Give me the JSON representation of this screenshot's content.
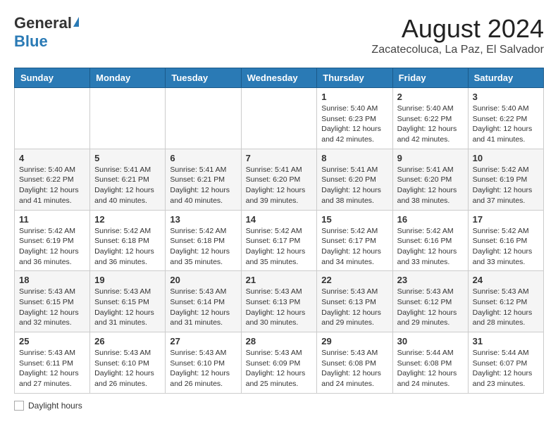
{
  "header": {
    "logo_general": "General",
    "logo_blue": "Blue",
    "month_title": "August 2024",
    "location": "Zacatecoluca, La Paz, El Salvador"
  },
  "days_of_week": [
    "Sunday",
    "Monday",
    "Tuesday",
    "Wednesday",
    "Thursday",
    "Friday",
    "Saturday"
  ],
  "weeks": [
    [
      {
        "day": "",
        "info": ""
      },
      {
        "day": "",
        "info": ""
      },
      {
        "day": "",
        "info": ""
      },
      {
        "day": "",
        "info": ""
      },
      {
        "day": "1",
        "info": "Sunrise: 5:40 AM\nSunset: 6:23 PM\nDaylight: 12 hours\nand 42 minutes."
      },
      {
        "day": "2",
        "info": "Sunrise: 5:40 AM\nSunset: 6:22 PM\nDaylight: 12 hours\nand 42 minutes."
      },
      {
        "day": "3",
        "info": "Sunrise: 5:40 AM\nSunset: 6:22 PM\nDaylight: 12 hours\nand 41 minutes."
      }
    ],
    [
      {
        "day": "4",
        "info": "Sunrise: 5:40 AM\nSunset: 6:22 PM\nDaylight: 12 hours\nand 41 minutes."
      },
      {
        "day": "5",
        "info": "Sunrise: 5:41 AM\nSunset: 6:21 PM\nDaylight: 12 hours\nand 40 minutes."
      },
      {
        "day": "6",
        "info": "Sunrise: 5:41 AM\nSunset: 6:21 PM\nDaylight: 12 hours\nand 40 minutes."
      },
      {
        "day": "7",
        "info": "Sunrise: 5:41 AM\nSunset: 6:20 PM\nDaylight: 12 hours\nand 39 minutes."
      },
      {
        "day": "8",
        "info": "Sunrise: 5:41 AM\nSunset: 6:20 PM\nDaylight: 12 hours\nand 38 minutes."
      },
      {
        "day": "9",
        "info": "Sunrise: 5:41 AM\nSunset: 6:20 PM\nDaylight: 12 hours\nand 38 minutes."
      },
      {
        "day": "10",
        "info": "Sunrise: 5:42 AM\nSunset: 6:19 PM\nDaylight: 12 hours\nand 37 minutes."
      }
    ],
    [
      {
        "day": "11",
        "info": "Sunrise: 5:42 AM\nSunset: 6:19 PM\nDaylight: 12 hours\nand 36 minutes."
      },
      {
        "day": "12",
        "info": "Sunrise: 5:42 AM\nSunset: 6:18 PM\nDaylight: 12 hours\nand 36 minutes."
      },
      {
        "day": "13",
        "info": "Sunrise: 5:42 AM\nSunset: 6:18 PM\nDaylight: 12 hours\nand 35 minutes."
      },
      {
        "day": "14",
        "info": "Sunrise: 5:42 AM\nSunset: 6:17 PM\nDaylight: 12 hours\nand 35 minutes."
      },
      {
        "day": "15",
        "info": "Sunrise: 5:42 AM\nSunset: 6:17 PM\nDaylight: 12 hours\nand 34 minutes."
      },
      {
        "day": "16",
        "info": "Sunrise: 5:42 AM\nSunset: 6:16 PM\nDaylight: 12 hours\nand 33 minutes."
      },
      {
        "day": "17",
        "info": "Sunrise: 5:42 AM\nSunset: 6:16 PM\nDaylight: 12 hours\nand 33 minutes."
      }
    ],
    [
      {
        "day": "18",
        "info": "Sunrise: 5:43 AM\nSunset: 6:15 PM\nDaylight: 12 hours\nand 32 minutes."
      },
      {
        "day": "19",
        "info": "Sunrise: 5:43 AM\nSunset: 6:15 PM\nDaylight: 12 hours\nand 31 minutes."
      },
      {
        "day": "20",
        "info": "Sunrise: 5:43 AM\nSunset: 6:14 PM\nDaylight: 12 hours\nand 31 minutes."
      },
      {
        "day": "21",
        "info": "Sunrise: 5:43 AM\nSunset: 6:13 PM\nDaylight: 12 hours\nand 30 minutes."
      },
      {
        "day": "22",
        "info": "Sunrise: 5:43 AM\nSunset: 6:13 PM\nDaylight: 12 hours\nand 29 minutes."
      },
      {
        "day": "23",
        "info": "Sunrise: 5:43 AM\nSunset: 6:12 PM\nDaylight: 12 hours\nand 29 minutes."
      },
      {
        "day": "24",
        "info": "Sunrise: 5:43 AM\nSunset: 6:12 PM\nDaylight: 12 hours\nand 28 minutes."
      }
    ],
    [
      {
        "day": "25",
        "info": "Sunrise: 5:43 AM\nSunset: 6:11 PM\nDaylight: 12 hours\nand 27 minutes."
      },
      {
        "day": "26",
        "info": "Sunrise: 5:43 AM\nSunset: 6:10 PM\nDaylight: 12 hours\nand 26 minutes."
      },
      {
        "day": "27",
        "info": "Sunrise: 5:43 AM\nSunset: 6:10 PM\nDaylight: 12 hours\nand 26 minutes."
      },
      {
        "day": "28",
        "info": "Sunrise: 5:43 AM\nSunset: 6:09 PM\nDaylight: 12 hours\nand 25 minutes."
      },
      {
        "day": "29",
        "info": "Sunrise: 5:43 AM\nSunset: 6:08 PM\nDaylight: 12 hours\nand 24 minutes."
      },
      {
        "day": "30",
        "info": "Sunrise: 5:44 AM\nSunset: 6:08 PM\nDaylight: 12 hours\nand 24 minutes."
      },
      {
        "day": "31",
        "info": "Sunrise: 5:44 AM\nSunset: 6:07 PM\nDaylight: 12 hours\nand 23 minutes."
      }
    ]
  ],
  "footer": {
    "daylight_label": "Daylight hours"
  }
}
